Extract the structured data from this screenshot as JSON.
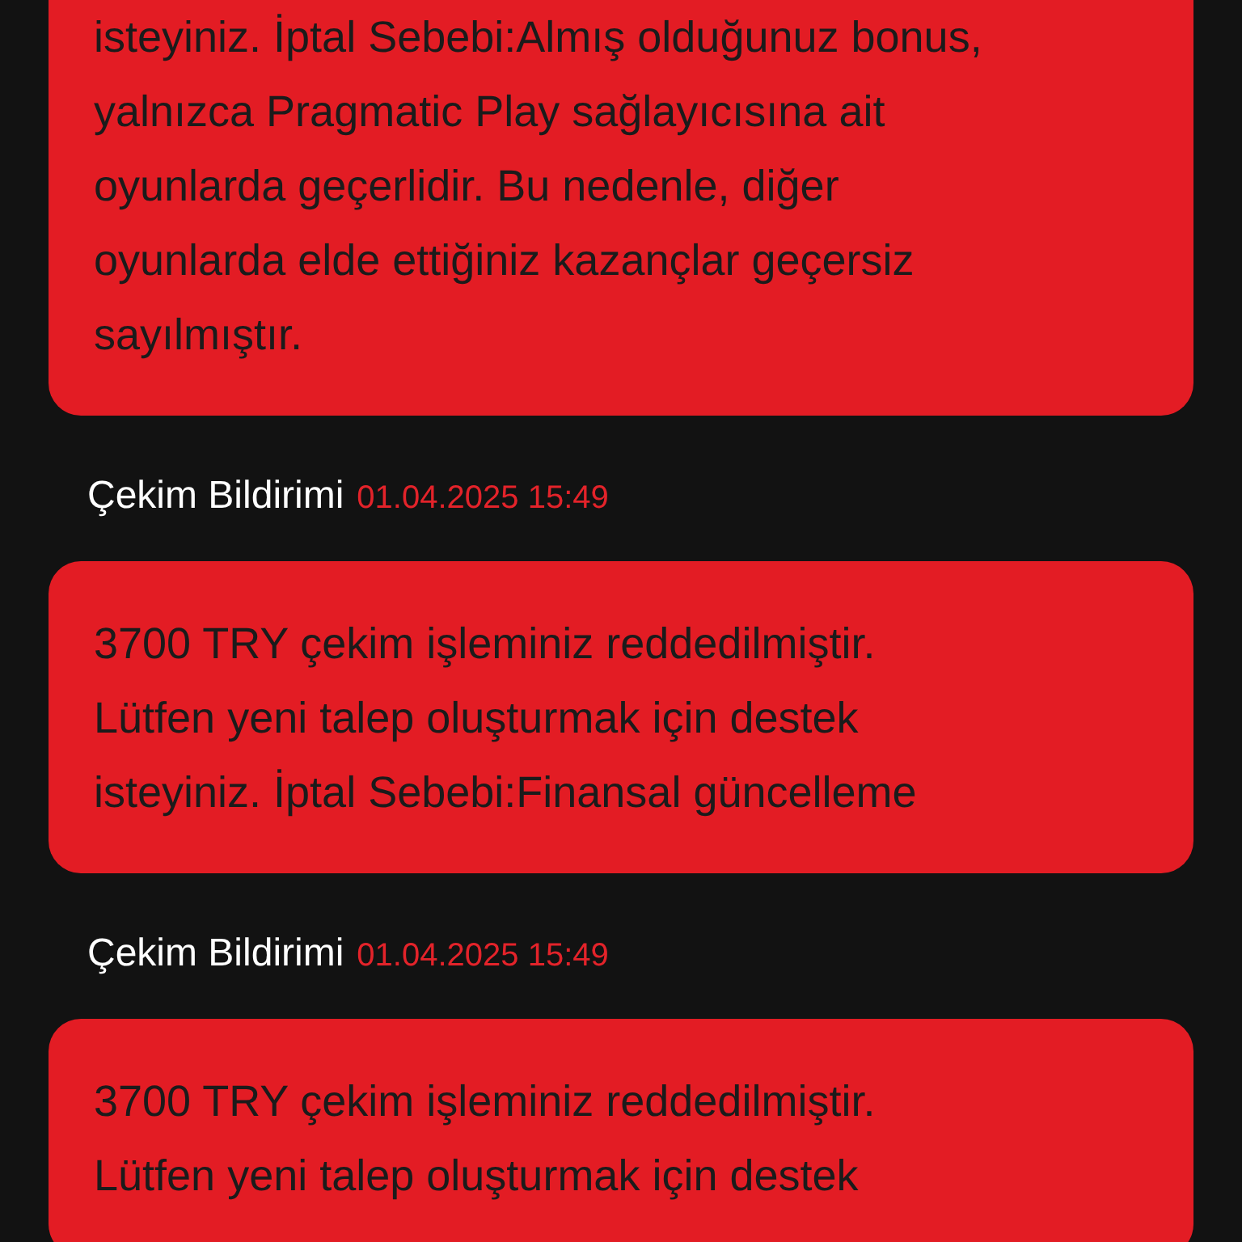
{
  "notifications": [
    {
      "lines": [
        "isteyiniz. İptal Sebebi:Almış olduğunuz bonus,",
        "yalnızca Pragmatic Play sağlayıcısına ait",
        "oyunlarda geçerlidir. Bu nedenle, diğer",
        "oyunlarda elde ettiğiniz kazançlar geçersiz",
        "sayılmıştır."
      ]
    },
    {
      "title": "Çekim Bildirimi",
      "date": "01.04.2025 15:49",
      "lines": [
        "3700 TRY çekim işleminiz reddedilmiştir.",
        "Lütfen yeni talep oluşturmak için destek",
        "isteyiniz. İptal Sebebi:Finansal güncelleme"
      ]
    },
    {
      "title": "Çekim Bildirimi",
      "date": "01.04.2025 15:49",
      "lines": [
        "3700 TRY çekim işleminiz reddedilmiştir.",
        "Lütfen yeni talep oluşturmak için destek"
      ]
    }
  ]
}
